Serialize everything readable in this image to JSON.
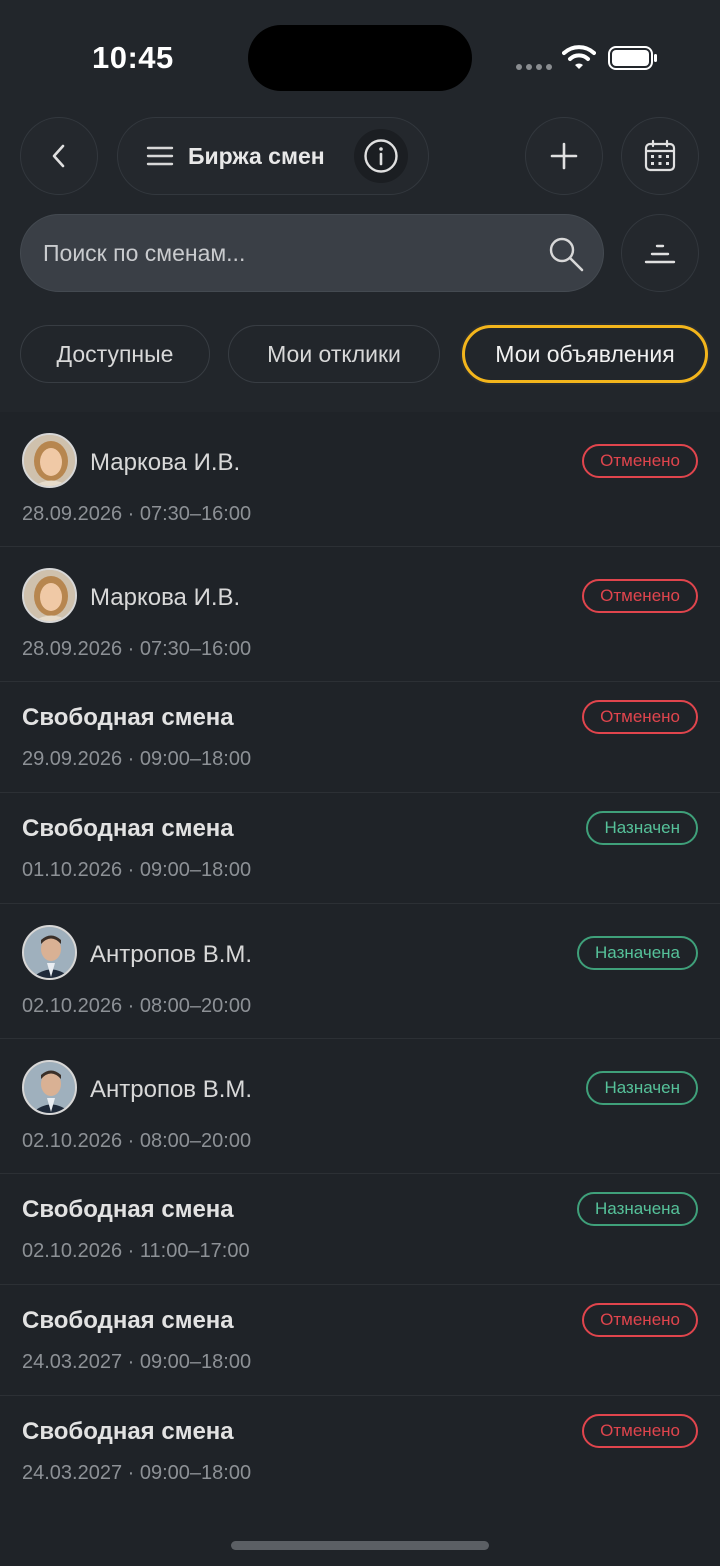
{
  "status_bar": {
    "time": "10:45"
  },
  "header": {
    "title": "Биржа смен",
    "back_icon": "chevron-left-icon",
    "menu_icon": "hamburger-icon",
    "info_icon": "info-icon",
    "add_icon": "plus-icon",
    "calendar_icon": "calendar-icon"
  },
  "search": {
    "placeholder": "Поиск по сменам...",
    "value": ""
  },
  "tabs": [
    {
      "label": "Доступные",
      "active": false
    },
    {
      "label": "Мои отклики",
      "active": false
    },
    {
      "label": "Мои объявления",
      "active": true
    }
  ],
  "colors": {
    "accent": "#f3b51c",
    "status_red": "#e0454d",
    "status_green": "#56c29a"
  },
  "shifts": [
    {
      "type": "person",
      "name": "Маркова И.В.",
      "avatar": "female",
      "date": "28.09.2026 · 07:30–16:00",
      "status": "Отменено",
      "status_color": "red"
    },
    {
      "type": "person",
      "name": "Маркова И.В.",
      "avatar": "female",
      "date": "28.09.2026 · 07:30–16:00",
      "status": "Отменено",
      "status_color": "red"
    },
    {
      "type": "free",
      "name": "Свободная смена",
      "date": "29.09.2026 · 09:00–18:00",
      "status": "Отменено",
      "status_color": "red"
    },
    {
      "type": "free",
      "name": "Свободная смена",
      "date": "01.10.2026 · 09:00–18:00",
      "status": "Назначен",
      "status_color": "green"
    },
    {
      "type": "person",
      "name": "Антропов В.М.",
      "avatar": "male",
      "date": "02.10.2026 · 08:00–20:00",
      "status": "Назначена",
      "status_color": "green"
    },
    {
      "type": "person",
      "name": "Антропов В.М.",
      "avatar": "male",
      "date": "02.10.2026 · 08:00–20:00",
      "status": "Назначен",
      "status_color": "green"
    },
    {
      "type": "free",
      "name": "Свободная смена",
      "date": "02.10.2026 · 11:00–17:00",
      "status": "Назначена",
      "status_color": "green"
    },
    {
      "type": "free",
      "name": "Свободная смена",
      "date": "24.03.2027 · 09:00–18:00",
      "status": "Отменено",
      "status_color": "red"
    },
    {
      "type": "free",
      "name": "Свободная смена",
      "date": "24.03.2027 · 09:00–18:00",
      "status": "Отменено",
      "status_color": "red"
    }
  ]
}
